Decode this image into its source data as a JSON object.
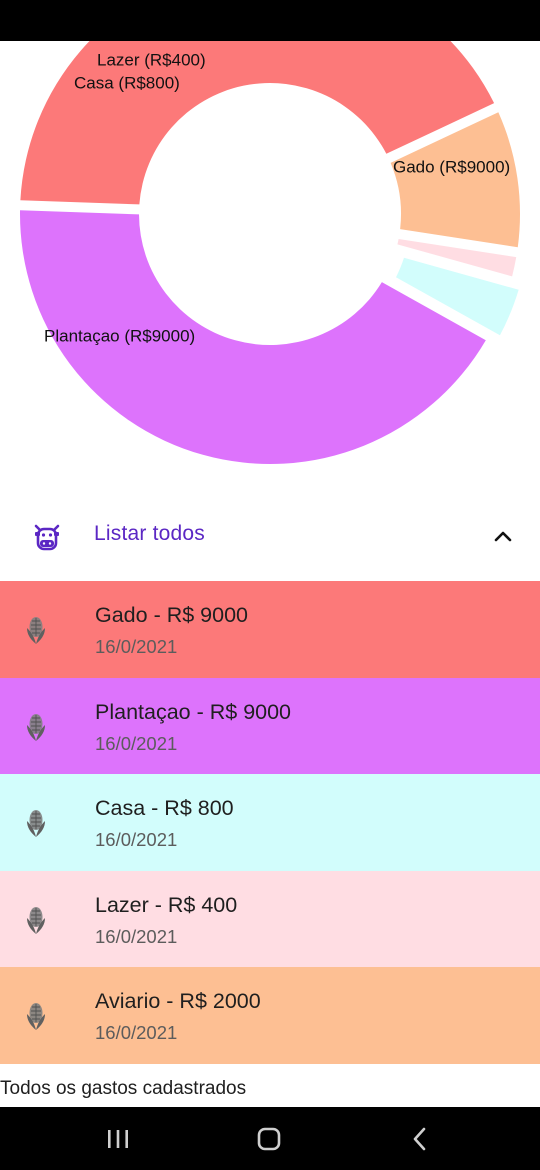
{
  "chart_data": {
    "type": "pie",
    "style": "donut",
    "categories": [
      "Gado",
      "Aviario",
      "Lazer",
      "Casa",
      "Plantaçao"
    ],
    "values": [
      9000,
      2000,
      400,
      800,
      9000
    ],
    "colors": [
      "#fc7979",
      "#fdbf93",
      "#ffdde3",
      "#d2fdfc",
      "#dd73fc"
    ],
    "slice_labels": [
      "Gado (R$9000)",
      "",
      "Lazer (R$400)",
      "Casa (R$800)",
      "Plantaçao (R$9000)"
    ]
  },
  "expander": {
    "title": "Listar todos",
    "leading_icon": "cow-icon",
    "trailing_icon": "chevron-up-icon",
    "accent_color": "#5b27c4"
  },
  "items": [
    {
      "title": "Gado - R$ 9000",
      "date": "16/0/2021",
      "color": "#fc7979",
      "icon": "corn-icon"
    },
    {
      "title": "Plantaçao - R$ 9000",
      "date": "16/0/2021",
      "color": "#dd73fc",
      "icon": "corn-icon"
    },
    {
      "title": "Casa - R$ 800",
      "date": "16/0/2021",
      "color": "#d2fdfc",
      "icon": "corn-icon"
    },
    {
      "title": "Lazer - R$ 400",
      "date": "16/0/2021",
      "color": "#ffdde3",
      "icon": "corn-icon"
    },
    {
      "title": "Aviario - R$ 2000",
      "date": "16/0/2021",
      "color": "#fdbf93",
      "icon": "corn-icon"
    }
  ],
  "footer": {
    "text": "Todos os gastos cadastrados"
  },
  "nav": {
    "recent": "recent-apps-icon",
    "home": "home-icon",
    "back": "back-icon"
  }
}
